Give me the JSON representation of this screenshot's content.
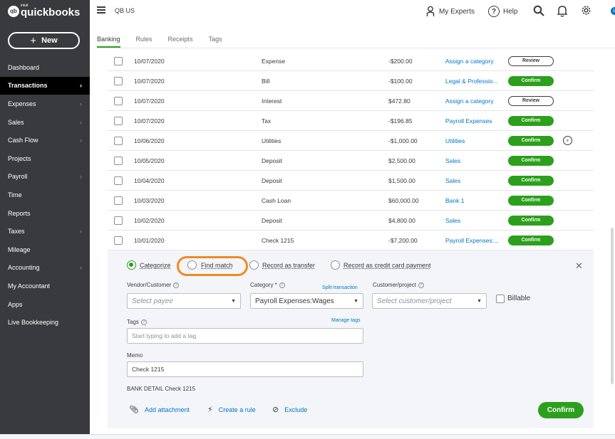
{
  "brand": {
    "mark": "qb",
    "intuit": "intuit",
    "name": "quickbooks"
  },
  "sidebar": {
    "new_label": "New",
    "items": [
      {
        "label": "Dashboard",
        "chevron": false,
        "active": false
      },
      {
        "label": "Transactions",
        "chevron": true,
        "active": true
      },
      {
        "label": "Expenses",
        "chevron": true,
        "active": false
      },
      {
        "label": "Sales",
        "chevron": true,
        "active": false
      },
      {
        "label": "Cash Flow",
        "chevron": true,
        "active": false
      },
      {
        "label": "Projects",
        "chevron": false,
        "active": false
      },
      {
        "label": "Payroll",
        "chevron": true,
        "active": false
      },
      {
        "label": "Time",
        "chevron": false,
        "active": false
      },
      {
        "label": "Reports",
        "chevron": false,
        "active": false
      },
      {
        "label": "Taxes",
        "chevron": true,
        "active": false
      },
      {
        "label": "Mileage",
        "chevron": false,
        "active": false
      },
      {
        "label": "Accounting",
        "chevron": true,
        "active": false
      },
      {
        "label": "My Accountant",
        "chevron": false,
        "active": false
      },
      {
        "label": "Apps",
        "chevron": false,
        "active": false
      },
      {
        "label": "Live Bookkeeping",
        "chevron": false,
        "active": false
      }
    ]
  },
  "topbar": {
    "company": "QB US",
    "my_experts": "My Experts",
    "help": "Help",
    "user_initial": "L"
  },
  "tabs": [
    "Banking",
    "Rules",
    "Receipts",
    "Tags"
  ],
  "rows": [
    {
      "date": "10/07/2020",
      "desc": "Expense",
      "amount": "-$200.00",
      "category": "Assign a category",
      "action": "Review",
      "bolt": false
    },
    {
      "date": "10/07/2020",
      "desc": "Bill",
      "amount": "-$100.00",
      "category": "Legal & Professio...",
      "action": "Confirm",
      "bolt": false
    },
    {
      "date": "10/07/2020",
      "desc": "Interest",
      "amount": "$472.80",
      "category": "Assign a category",
      "action": "Review",
      "bolt": false
    },
    {
      "date": "10/07/2020",
      "desc": "Tax",
      "amount": "-$196.85",
      "category": "Payroll Expenses",
      "action": "Confirm",
      "bolt": false
    },
    {
      "date": "10/06/2020",
      "desc": "Utilities",
      "amount": "-$1,000.00",
      "category": "Utilities",
      "action": "Confirm",
      "bolt": true
    },
    {
      "date": "10/05/2020",
      "desc": "Deposit",
      "amount": "$2,500.00",
      "category": "Sales",
      "action": "Confirm",
      "bolt": false
    },
    {
      "date": "10/04/2020",
      "desc": "Deposit",
      "amount": "$1,500.00",
      "category": "Sales",
      "action": "Confirm",
      "bolt": false
    },
    {
      "date": "10/03/2020",
      "desc": "Cash Loan",
      "amount": "$60,000.00",
      "category": "Bank 1",
      "action": "Confirm",
      "bolt": false
    },
    {
      "date": "10/02/2020",
      "desc": "Deposit",
      "amount": "$4,800.00",
      "category": "Sales",
      "action": "Confirm",
      "bolt": false
    },
    {
      "date": "10/01/2020",
      "desc": "Check 1215",
      "amount": "-$7,200.00",
      "category": "Payroll Expenses:...",
      "action": "Confirm",
      "bolt": false
    }
  ],
  "panel": {
    "radios": {
      "categorize": "Categorize",
      "find_match": "Find match",
      "record_transfer": "Record as transfer",
      "record_cc": "Record as credit card payment"
    },
    "vendor_label": "Vendor/Customer",
    "vendor_placeholder": "Select payee",
    "category_label": "Category *",
    "split_link": "Split transaction",
    "category_value": "Payroll Expenses:Wages",
    "customer_label": "Customer/project",
    "customer_placeholder": "Select customer/project",
    "billable_label": "Billable",
    "tags_label": "Tags",
    "manage_tags": "Manage tags",
    "tags_placeholder": "Start typing to add a tag",
    "memo_label": "Memo",
    "memo_value": "Check 1215",
    "bank_detail_label": "BANK DETAIL",
    "bank_detail_value": "Check 1215",
    "add_attachment": "Add attachment",
    "create_rule": "Create a rule",
    "exclude": "Exclude",
    "confirm_label": "Confirm"
  },
  "colors": {
    "accent": "#2ca01c",
    "link": "#0077c5",
    "sidebar": "#393a3d",
    "highlight": "#f08a24"
  }
}
